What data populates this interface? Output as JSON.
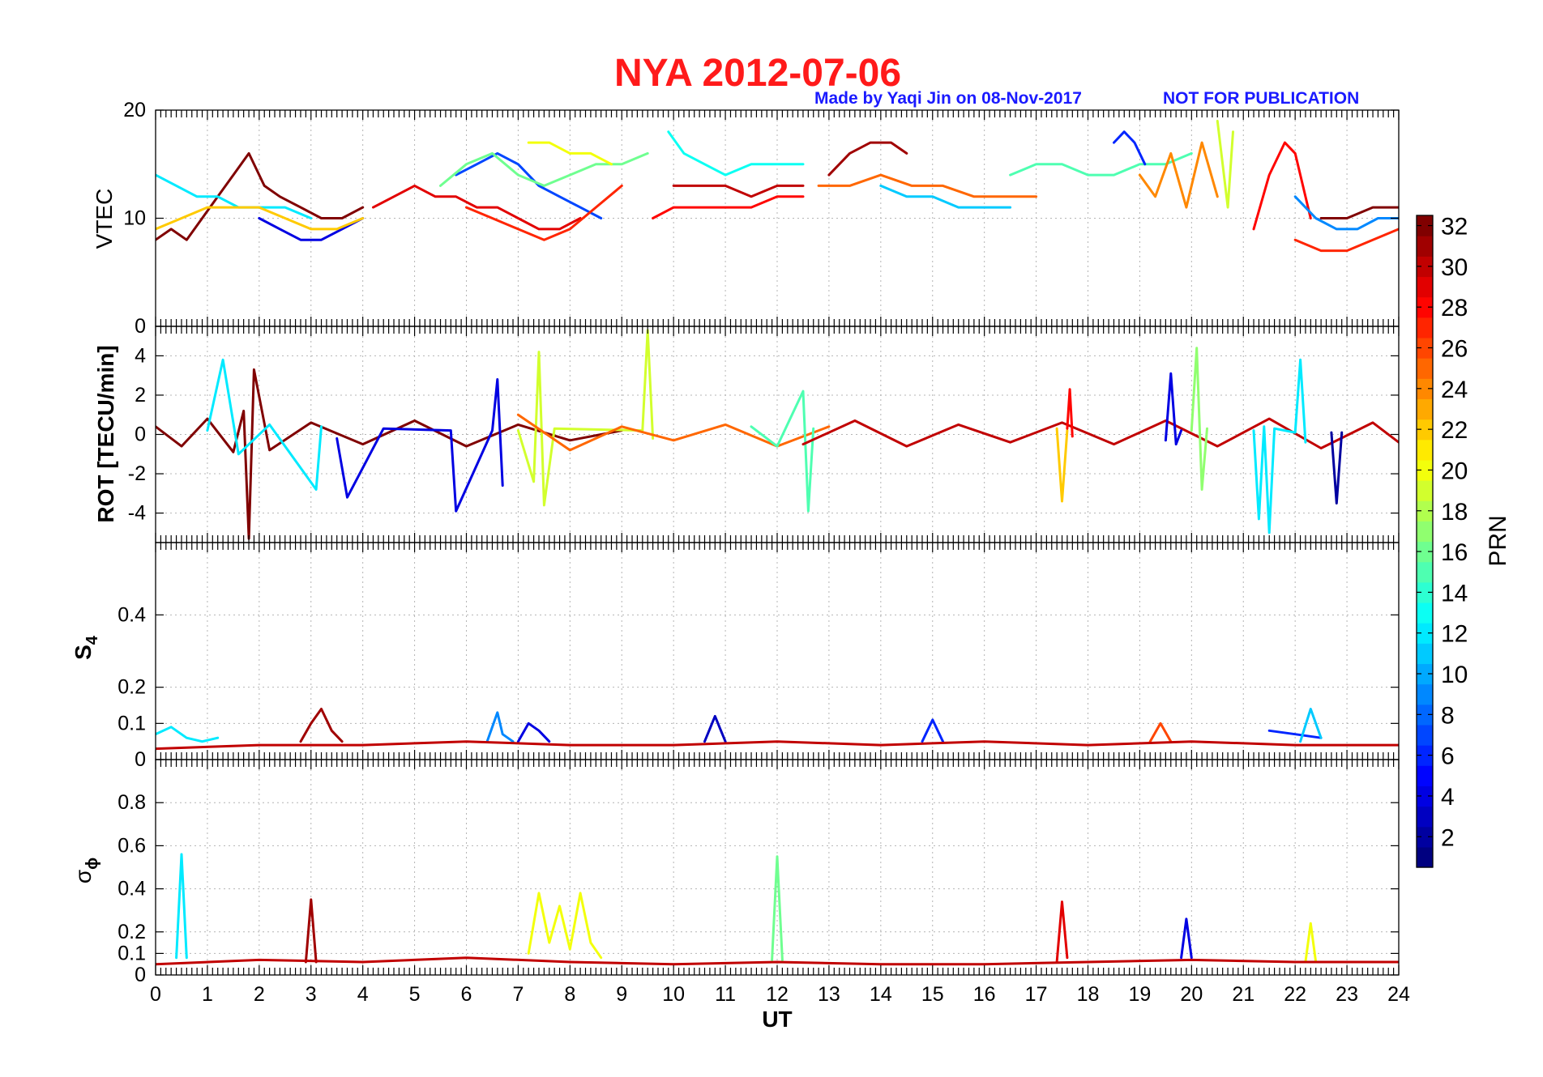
{
  "figure": {
    "title": "NYA   2012-07-06",
    "credit": "Made by Yaqi Jin on 08-Nov-2017",
    "notice": "NOT FOR PUBLICATION",
    "title_color": "#ff1a1a",
    "credit_color": "#1a1aff"
  },
  "chart_data": [
    {
      "type": "line",
      "panel": "vtec",
      "ylabel": "VTEC",
      "ylim": [
        0,
        20
      ],
      "yticks": [
        "0",
        "10",
        "20"
      ],
      "xlim": [
        0,
        24
      ],
      "grid": true,
      "color_by": "PRN",
      "series": [
        {
          "prn": 32,
          "x": [
            0.0,
            0.3,
            0.6,
            0.9,
            1.2,
            1.5,
            1.8,
            2.1,
            2.4,
            2.8,
            3.2,
            3.6,
            4.0
          ],
          "y": [
            8,
            9,
            8,
            10,
            12,
            14,
            16,
            13,
            12,
            11,
            10,
            10,
            11
          ]
        },
        {
          "prn": 12,
          "x": [
            0.0,
            0.4,
            0.8,
            1.2,
            1.6,
            2.0,
            2.5,
            3.0
          ],
          "y": [
            14,
            13,
            12,
            12,
            11,
            11,
            11,
            10
          ]
        },
        {
          "prn": 4,
          "x": [
            2.0,
            2.4,
            2.8,
            3.2,
            3.6,
            4.0
          ],
          "y": [
            10,
            9,
            8,
            8,
            9,
            10
          ]
        },
        {
          "prn": 22,
          "x": [
            0.0,
            0.5,
            1.0,
            1.5,
            2.0,
            2.5,
            3.0,
            3.5,
            4.0
          ],
          "y": [
            9,
            10,
            11,
            11,
            11,
            10,
            9,
            9,
            10
          ]
        },
        {
          "prn": 29,
          "x": [
            4.2,
            4.6,
            5.0,
            5.4,
            5.8,
            6.2,
            6.6,
            7.0,
            7.4,
            7.8,
            8.2
          ],
          "y": [
            11,
            12,
            13,
            12,
            12,
            11,
            11,
            10,
            9,
            9,
            10
          ]
        },
        {
          "prn": 7,
          "x": [
            5.8,
            6.2,
            6.6,
            7.0,
            7.4,
            7.8,
            8.2,
            8.6
          ],
          "y": [
            14,
            15,
            16,
            15,
            13,
            12,
            11,
            10
          ]
        },
        {
          "prn": 16,
          "x": [
            5.5,
            6.0,
            6.5,
            7.0,
            7.5,
            8.0,
            8.5,
            9.0,
            9.5
          ],
          "y": [
            13,
            15,
            16,
            14,
            13,
            14,
            15,
            15,
            16
          ]
        },
        {
          "prn": 20,
          "x": [
            7.2,
            7.6,
            8.0,
            8.4,
            8.8
          ],
          "y": [
            17,
            17,
            16,
            16,
            15
          ]
        },
        {
          "prn": 27,
          "x": [
            6.0,
            6.5,
            7.0,
            7.5,
            8.0,
            8.5,
            9.0
          ],
          "y": [
            11,
            10,
            9,
            8,
            9,
            11,
            13
          ]
        },
        {
          "prn": 13,
          "x": [
            9.9,
            10.2,
            10.6,
            11.0,
            11.5,
            12.0,
            12.5
          ],
          "y": [
            18,
            16,
            15,
            14,
            15,
            15,
            15
          ]
        },
        {
          "prn": 28,
          "x": [
            9.6,
            10.0,
            10.5,
            11.0,
            11.5,
            12.0,
            12.5
          ],
          "y": [
            10,
            11,
            11,
            11,
            11,
            12,
            12
          ]
        },
        {
          "prn": 30,
          "x": [
            10.0,
            10.5,
            11.0,
            11.5,
            12.0,
            12.5
          ],
          "y": [
            13,
            13,
            13,
            12,
            13,
            13
          ]
        },
        {
          "prn": 31,
          "x": [
            13.0,
            13.4,
            13.8,
            14.2,
            14.5
          ],
          "y": [
            14,
            16,
            17,
            17,
            16
          ]
        },
        {
          "prn": 25,
          "x": [
            12.8,
            13.4,
            14.0,
            14.6,
            15.2,
            15.8,
            16.4,
            17.0
          ],
          "y": [
            13,
            13,
            14,
            13,
            13,
            12,
            12,
            12
          ]
        },
        {
          "prn": 11,
          "x": [
            14.0,
            14.5,
            15.0,
            15.5,
            16.0,
            16.5
          ],
          "y": [
            13,
            12,
            12,
            11,
            11,
            11
          ]
        },
        {
          "prn": 15,
          "x": [
            16.5,
            17.0,
            17.5,
            18.0,
            18.5,
            19.0,
            19.5,
            20.0
          ],
          "y": [
            14,
            15,
            15,
            14,
            14,
            15,
            15,
            16
          ]
        },
        {
          "prn": 6,
          "x": [
            18.5,
            18.7,
            18.9,
            19.1
          ],
          "y": [
            17,
            18,
            17,
            15
          ]
        },
        {
          "prn": 24,
          "x": [
            19.0,
            19.3,
            19.6,
            19.9,
            20.2,
            20.5
          ],
          "y": [
            14,
            12,
            16,
            11,
            17,
            12
          ]
        },
        {
          "prn": 19,
          "x": [
            20.5,
            20.6,
            20.7,
            20.8
          ],
          "y": [
            19,
            15,
            11,
            18
          ]
        },
        {
          "prn": 28,
          "x": [
            21.2,
            21.5,
            21.8,
            22.0,
            22.3
          ],
          "y": [
            9,
            14,
            17,
            16,
            10
          ]
        },
        {
          "prn": 27,
          "x": [
            22.0,
            22.5,
            23.0,
            23.5,
            24.0
          ],
          "y": [
            8,
            7,
            7,
            8,
            9
          ]
        },
        {
          "prn": 9,
          "x": [
            22.0,
            22.4,
            22.8,
            23.2,
            23.6,
            24.0
          ],
          "y": [
            12,
            10,
            9,
            9,
            10,
            10
          ]
        },
        {
          "prn": 32,
          "x": [
            22.5,
            23.0,
            23.5,
            24.0
          ],
          "y": [
            10,
            10,
            11,
            11
          ]
        }
      ]
    },
    {
      "type": "line",
      "panel": "rot",
      "ylabel": "ROT [TECU/min]",
      "ylim": [
        -5.5,
        5.5
      ],
      "yticks": [
        "-4",
        "-2",
        "0",
        "2",
        "4"
      ],
      "xlim": [
        0,
        24
      ],
      "grid": true,
      "color_by": "PRN",
      "series": [
        {
          "prn": 32,
          "x": [
            0.0,
            0.5,
            1.0,
            1.5,
            1.7,
            1.8,
            1.9,
            2.2,
            3.0,
            4.0,
            5.0,
            6.0,
            7.0,
            8.0,
            9.0
          ],
          "y": [
            0.4,
            -0.6,
            0.8,
            -0.9,
            1.2,
            -5.3,
            3.3,
            -0.8,
            0.6,
            -0.5,
            0.7,
            -0.6,
            0.5,
            -0.3,
            0.2
          ]
        },
        {
          "prn": 12,
          "x": [
            1.0,
            1.3,
            1.6,
            2.2,
            3.1,
            3.2
          ],
          "y": [
            0.2,
            3.8,
            -1.0,
            0.5,
            -2.8,
            0.4
          ]
        },
        {
          "prn": 4,
          "x": [
            3.5,
            3.7,
            4.4,
            5.7,
            5.8,
            6.5,
            6.6,
            6.7
          ],
          "y": [
            -0.2,
            -3.2,
            0.3,
            0.2,
            -3.9,
            0.2,
            2.8,
            -2.6
          ]
        },
        {
          "prn": 19,
          "x": [
            7.0,
            7.3,
            7.4,
            7.5,
            7.7,
            9.4,
            9.5,
            9.6
          ],
          "y": [
            0.2,
            -2.4,
            4.2,
            -3.6,
            0.3,
            0.2,
            5.3,
            -0.2
          ]
        },
        {
          "prn": 25,
          "x": [
            7.0,
            8.0,
            9.0,
            10.0,
            11.0,
            12.0,
            13.0
          ],
          "y": [
            1.0,
            -0.8,
            0.4,
            -0.3,
            0.5,
            -0.6,
            0.4
          ]
        },
        {
          "prn": 15,
          "x": [
            11.5,
            12.0,
            12.5,
            12.6,
            12.7
          ],
          "y": [
            0.4,
            -0.6,
            2.2,
            -3.9,
            0.3
          ]
        },
        {
          "prn": 30,
          "x": [
            12.5,
            13.5,
            14.5,
            15.5,
            16.5,
            17.5,
            18.5,
            19.5,
            20.5,
            21.5,
            22.5,
            23.5,
            24.0
          ],
          "y": [
            -0.5,
            0.7,
            -0.6,
            0.5,
            -0.4,
            0.6,
            -0.5,
            0.7,
            -0.6,
            0.8,
            -0.7,
            0.6,
            -0.4
          ]
        },
        {
          "prn": 22,
          "x": [
            17.4,
            17.5,
            17.6
          ],
          "y": [
            0.3,
            -3.4,
            0.2
          ]
        },
        {
          "prn": 28,
          "x": [
            17.6,
            17.65,
            17.7
          ],
          "y": [
            0.3,
            2.3,
            -0.1
          ]
        },
        {
          "prn": 4,
          "x": [
            19.5,
            19.6,
            19.7,
            19.8
          ],
          "y": [
            -0.3,
            3.1,
            -0.5,
            0.2
          ]
        },
        {
          "prn": 17,
          "x": [
            20.0,
            20.1,
            20.2,
            20.3
          ],
          "y": [
            0.2,
            4.4,
            -2.8,
            0.3
          ]
        },
        {
          "prn": 12,
          "x": [
            21.2,
            21.3,
            21.4,
            21.5,
            21.6,
            22.0,
            22.1,
            22.2
          ],
          "y": [
            0.2,
            -4.3,
            0.4,
            -5.0,
            0.3,
            0.1,
            3.8,
            -0.4
          ]
        },
        {
          "prn": 2,
          "x": [
            22.7,
            22.8,
            22.9
          ],
          "y": [
            0.1,
            -3.5,
            0.1
          ]
        }
      ]
    },
    {
      "type": "line",
      "panel": "s4",
      "ylabel": "S4",
      "ylim": [
        0,
        0.6
      ],
      "yticks": [
        "0",
        "0.1",
        "0.2",
        "0.4"
      ],
      "xlim": [
        0,
        24
      ],
      "grid": true,
      "color_by": "PRN",
      "series": [
        {
          "prn": 12,
          "x": [
            0.0,
            0.3,
            0.6,
            0.9,
            1.2
          ],
          "y": [
            0.07,
            0.09,
            0.06,
            0.05,
            0.06
          ]
        },
        {
          "prn": 31,
          "x": [
            2.8,
            3.0,
            3.2,
            3.4,
            3.6
          ],
          "y": [
            0.05,
            0.1,
            0.14,
            0.08,
            0.05
          ]
        },
        {
          "prn": 9,
          "x": [
            6.4,
            6.6,
            6.7,
            6.9
          ],
          "y": [
            0.05,
            0.13,
            0.07,
            0.05
          ]
        },
        {
          "prn": 4,
          "x": [
            7.0,
            7.2,
            7.4,
            7.6
          ],
          "y": [
            0.05,
            0.1,
            0.08,
            0.05
          ]
        },
        {
          "prn": 3,
          "x": [
            10.6,
            10.8,
            11.0
          ],
          "y": [
            0.05,
            0.12,
            0.05
          ]
        },
        {
          "prn": 6,
          "x": [
            14.8,
            15.0,
            15.2
          ],
          "y": [
            0.05,
            0.11,
            0.05
          ]
        },
        {
          "prn": 26,
          "x": [
            19.2,
            19.4,
            19.6
          ],
          "y": [
            0.05,
            0.1,
            0.05
          ]
        },
        {
          "prn": 6,
          "x": [
            21.5,
            22.0,
            22.5
          ],
          "y": [
            0.08,
            0.07,
            0.06
          ]
        },
        {
          "prn": 11,
          "x": [
            22.1,
            22.3,
            22.5
          ],
          "y": [
            0.05,
            0.14,
            0.06
          ]
        },
        {
          "prn": 30,
          "x": [
            0.0,
            2.0,
            4.0,
            6.0,
            8.0,
            10.0,
            12.0,
            14.0,
            16.0,
            18.0,
            20.0,
            22.0,
            24.0
          ],
          "y": [
            0.03,
            0.04,
            0.04,
            0.05,
            0.04,
            0.04,
            0.05,
            0.04,
            0.05,
            0.04,
            0.05,
            0.04,
            0.04
          ]
        }
      ]
    },
    {
      "type": "line",
      "panel": "sigma_phi",
      "ylabel": "σϕ",
      "xlabel": "UT",
      "ylim": [
        0,
        1
      ],
      "yticks": [
        "0",
        "0.1",
        "0.2",
        "0.4",
        "0.6",
        "0.8"
      ],
      "xticks": [
        "0",
        "1",
        "2",
        "3",
        "4",
        "5",
        "6",
        "7",
        "8",
        "9",
        "10",
        "11",
        "12",
        "13",
        "14",
        "15",
        "16",
        "17",
        "18",
        "19",
        "20",
        "21",
        "22",
        "23",
        "24"
      ],
      "xlim": [
        0,
        24
      ],
      "grid": true,
      "color_by": "PRN",
      "series": [
        {
          "prn": 12,
          "x": [
            0.4,
            0.5,
            0.6
          ],
          "y": [
            0.08,
            0.56,
            0.08
          ]
        },
        {
          "prn": 31,
          "x": [
            2.9,
            3.0,
            3.1
          ],
          "y": [
            0.06,
            0.35,
            0.06
          ]
        },
        {
          "prn": 20,
          "x": [
            7.2,
            7.4,
            7.6,
            7.8,
            8.0,
            8.2,
            8.4,
            8.6
          ],
          "y": [
            0.1,
            0.38,
            0.15,
            0.32,
            0.12,
            0.38,
            0.15,
            0.08
          ]
        },
        {
          "prn": 16,
          "x": [
            11.9,
            12.0,
            12.1
          ],
          "y": [
            0.07,
            0.55,
            0.07
          ]
        },
        {
          "prn": 29,
          "x": [
            17.4,
            17.5,
            17.6
          ],
          "y": [
            0.06,
            0.34,
            0.08
          ]
        },
        {
          "prn": 4,
          "x": [
            19.8,
            19.9,
            20.0
          ],
          "y": [
            0.08,
            0.26,
            0.08
          ]
        },
        {
          "prn": 20,
          "x": [
            22.2,
            22.3,
            22.4
          ],
          "y": [
            0.06,
            0.24,
            0.06
          ]
        },
        {
          "prn": 30,
          "x": [
            0.0,
            2.0,
            4.0,
            6.0,
            8.0,
            10.0,
            12.0,
            14.0,
            16.0,
            18.0,
            20.0,
            22.0,
            24.0
          ],
          "y": [
            0.05,
            0.07,
            0.06,
            0.08,
            0.06,
            0.05,
            0.06,
            0.05,
            0.05,
            0.06,
            0.07,
            0.06,
            0.06
          ]
        }
      ]
    }
  ],
  "colorbar": {
    "label": "PRN",
    "ticks": [
      "2",
      "4",
      "6",
      "8",
      "10",
      "12",
      "14",
      "16",
      "18",
      "20",
      "22",
      "24",
      "26",
      "28",
      "30",
      "32"
    ],
    "range": [
      1,
      32
    ],
    "colormap": "jet"
  }
}
